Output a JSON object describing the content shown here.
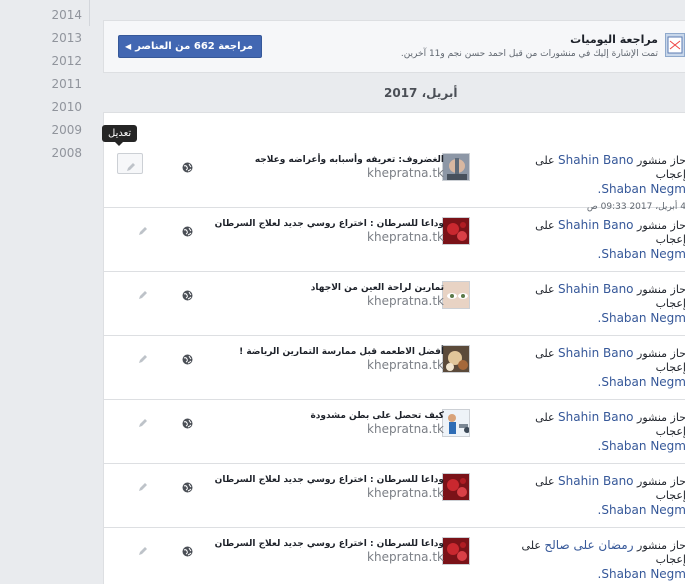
{
  "years": [
    "2014",
    "2013",
    "2012",
    "2011",
    "2010",
    "2009",
    "2008"
  ],
  "review": {
    "title": "مراجعة اليوميات",
    "subtitle": "تمت الإشارة إليك في منشورات من قبل احمد حسن نجم و11 آخرين.",
    "button_label": "مراجعة 662 من العناصر"
  },
  "date_header": "أبريل، 2017",
  "tooltip": "تعديل",
  "rows": [
    {
      "action": "حاز منشور",
      "actor": "Shahin Bano",
      "connector": "على إعجاب",
      "target": "Shaban Negm.",
      "timestamp": "4 أبريل، 2017 09:33 ص",
      "post_title": "الغضروف: تعريفه وأسبابه وأعراضه وعلاجه",
      "domain": "khepratna.tk",
      "thumb": "spine"
    },
    {
      "action": "حاز منشور",
      "actor": "Shahin Bano",
      "connector": "على إعجاب",
      "target": "Shaban Negm.",
      "post_title": "وداعا للسرطان : اختراع روسي جديد لعلاج السرطان",
      "domain": "khepratna.tk",
      "thumb": "cells"
    },
    {
      "action": "حاز منشور",
      "actor": "Shahin Bano",
      "connector": "على إعجاب",
      "target": "Shaban Negm.",
      "post_title": "تمارين لراحة العين من الاجهاد",
      "domain": "khepratna.tk",
      "thumb": "eye"
    },
    {
      "action": "حاز منشور",
      "actor": "Shahin Bano",
      "connector": "على إعجاب",
      "target": "Shaban Negm.",
      "post_title": "أفضل الاطعمه قبل ممارسة التمارين الرياضة !",
      "domain": "khepratna.tk",
      "thumb": "food"
    },
    {
      "action": "حاز منشور",
      "actor": "Shahin Bano",
      "connector": "على إعجاب",
      "target": "Shaban Negm.",
      "post_title": "كيف تحصل على بطن مشدودة",
      "domain": "khepratna.tk",
      "thumb": "fitness"
    },
    {
      "action": "حاز منشور",
      "actor": "Shahin Bano",
      "connector": "على إعجاب",
      "target": "Shaban Negm.",
      "post_title": "وداعا للسرطان : اختراع روسي جديد لعلاج السرطان",
      "domain": "khepratna.tk",
      "thumb": "cells"
    },
    {
      "action": "حاز منشور",
      "actor": "رمضان على صالح",
      "connector": "على إعجاب",
      "target": "Shaban Negm.",
      "post_title": "وداعا للسرطان : اختراع روسي جديد لعلاج السرطان",
      "domain": "khepratna.tk",
      "thumb": "cells"
    }
  ]
}
